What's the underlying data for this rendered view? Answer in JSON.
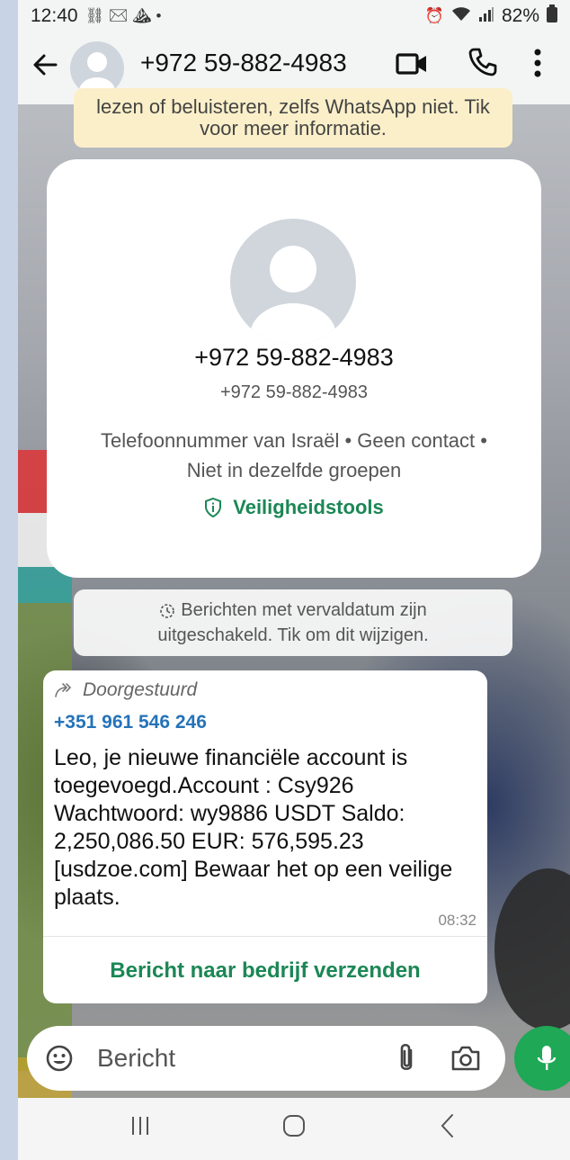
{
  "status_bar": {
    "time": "12:40",
    "notification_glyphs": "⛓ ✉ ⛰ •",
    "battery": "82%"
  },
  "header": {
    "title": "+972 59-882-4983"
  },
  "notice_banner": {
    "line1": "lezen of beluisteren, zelfs WhatsApp niet. Tik",
    "line2": "voor meer informatie."
  },
  "contact_card": {
    "name": "+972 59-882-4983",
    "phone": "+972 59-882-4983",
    "description": "Telefoonnummer van Israël • Geen contact • Niet in dezelfde groepen",
    "tools_label": "Veiligheidstools"
  },
  "expire_notice": {
    "line1": "Berichten met vervaldatum zijn",
    "line2": "uitgeschakeld. Tik om dit wijzigen."
  },
  "message": {
    "forwarded_label": "Doorgestuurd",
    "sender": "+351 961 546 246",
    "body": "Leo, je nieuwe financiële account is toegevoegd.Account : Csy926 Wachtwoord: wy9886 USDT Saldo: 2,250,086.50 EUR: 576,595.23 [usdzoe.com] Bewaar het op een veilige plaats.",
    "time": "08:32",
    "action_label": "Bericht naar bedrijf verzenden"
  },
  "input_bar": {
    "placeholder": "Bericht"
  },
  "colors": {
    "accent_green": "#1b8755",
    "link_blue": "#2573b8",
    "banner_yellow": "#fbefc9",
    "mic_green": "#1fa855"
  },
  "icons": [
    "back-arrow-icon",
    "video-icon",
    "call-icon",
    "menu-icon",
    "shield-icon",
    "timer-icon",
    "forward-icon",
    "emoji-icon",
    "attach-icon",
    "camera-icon",
    "mic-icon"
  ]
}
